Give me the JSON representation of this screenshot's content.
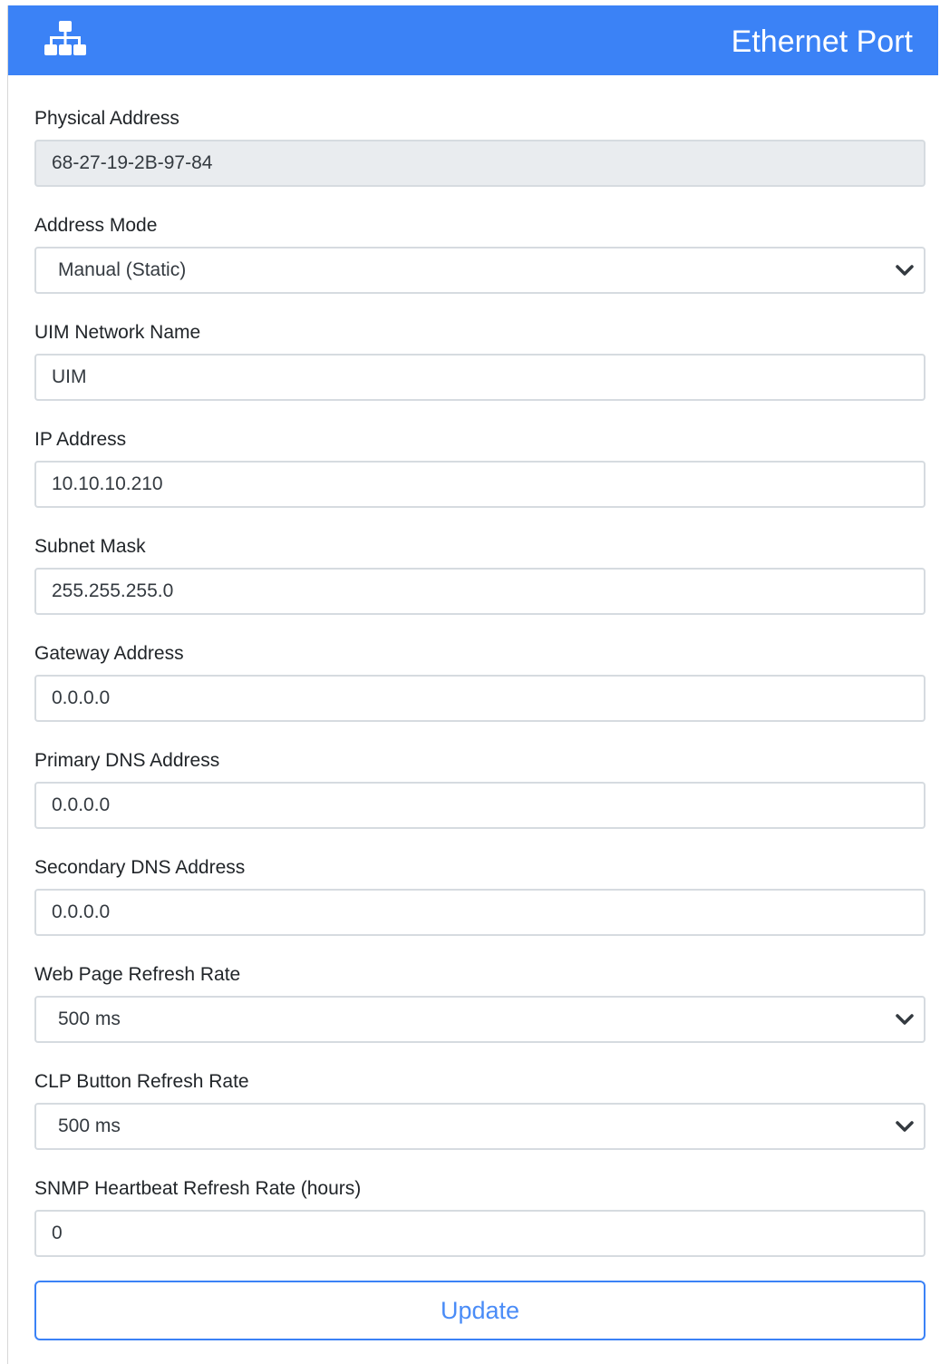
{
  "header": {
    "title": "Ethernet Port",
    "icon": "sitemap-icon",
    "background_color": "#3b82f6"
  },
  "fields": [
    {
      "label": "Physical Address",
      "value": "68-27-19-2B-97-84",
      "type": "readonly"
    },
    {
      "label": "Address Mode",
      "value": "Manual (Static)",
      "type": "select"
    },
    {
      "label": "UIM Network Name",
      "value": "UIM",
      "type": "input"
    },
    {
      "label": "IP Address",
      "value": "10.10.10.210",
      "type": "input"
    },
    {
      "label": "Subnet Mask",
      "value": "255.255.255.0",
      "type": "input"
    },
    {
      "label": "Gateway Address",
      "value": "0.0.0.0",
      "type": "input"
    },
    {
      "label": "Primary DNS Address",
      "value": "0.0.0.0",
      "type": "input"
    },
    {
      "label": "Secondary DNS Address",
      "value": "0.0.0.0",
      "type": "input"
    },
    {
      "label": "Web Page Refresh Rate",
      "value": "500 ms",
      "type": "select"
    },
    {
      "label": "CLP Button Refresh Rate",
      "value": "500 ms",
      "type": "select"
    },
    {
      "label": "SNMP Heartbeat Refresh Rate (hours)",
      "value": "0",
      "type": "input"
    }
  ],
  "update_button": {
    "label": "Update",
    "color": "#3b82f6"
  }
}
